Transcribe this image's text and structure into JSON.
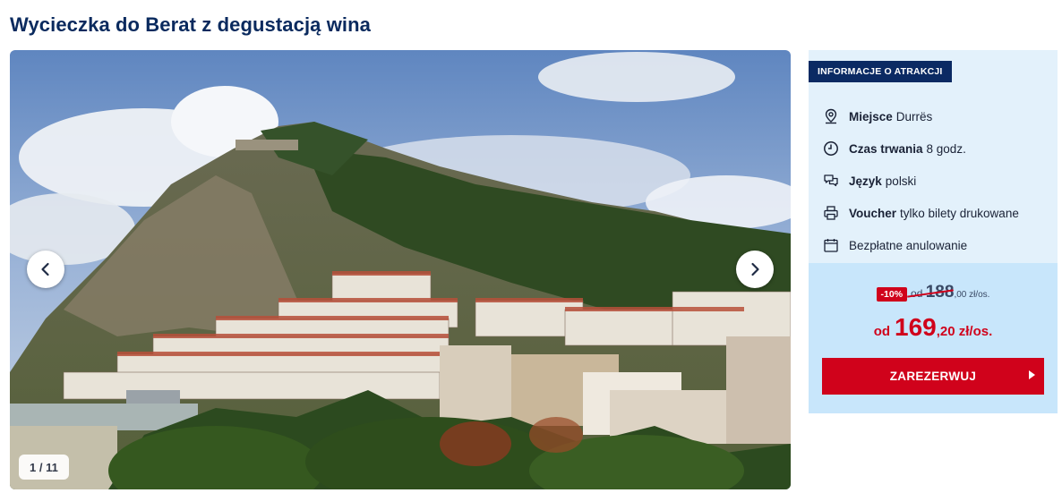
{
  "page": {
    "title": "Wycieczka do Berat z degustacją wina"
  },
  "gallery": {
    "counter": "1 / 11",
    "prev_icon": "chevron-left-icon",
    "next_icon": "chevron-right-icon"
  },
  "info": {
    "badge": "INFORMACJE O ATRAKCJI",
    "items": [
      {
        "icon": "location-pin-icon",
        "label": "Miejsce",
        "value": "Durrës"
      },
      {
        "icon": "clock-icon",
        "label": "Czas trwania",
        "value": "8 godz."
      },
      {
        "icon": "speech-bubble-icon",
        "label": "Język",
        "value": "polski"
      },
      {
        "icon": "printer-icon",
        "label": "Voucher",
        "value": "tylko bilety drukowane"
      },
      {
        "icon": "calendar-icon",
        "label": "",
        "value": "Bezpłatne anulowanie"
      }
    ]
  },
  "pricing": {
    "discount": "-10%",
    "old_prefix": "od",
    "old_main": "188",
    "old_cents": ",00 zł/os.",
    "new_prefix": "od",
    "new_main": "169",
    "new_cents": ",20 zł/os.",
    "reserve_label": "ZAREZERWUJ"
  },
  "colors": {
    "title": "#0a2a5e",
    "badge_bg": "#0b2a63",
    "panel_bg": "#e3f1fb",
    "price_bg": "#c8e6fb",
    "accent_red": "#d0021b"
  }
}
